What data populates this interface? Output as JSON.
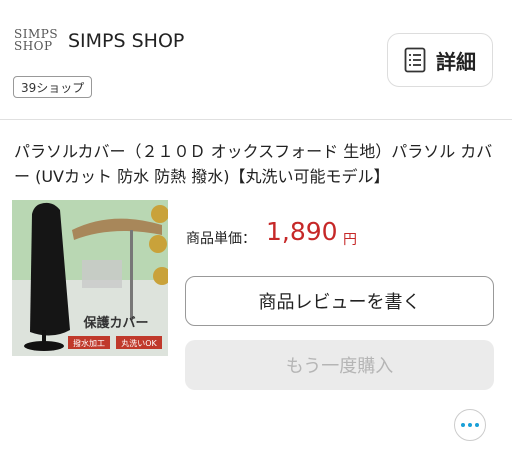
{
  "shop": {
    "logo_line1": "SIMPS",
    "logo_line2": "SHOP",
    "name": "SIMPS SHOP",
    "tag": "39ショップ"
  },
  "header": {
    "details_label": "詳細",
    "details_icon": "document-list-icon"
  },
  "product": {
    "title": "パラソルカバー（２１０Ｄ オックスフォード 生地）パラソル カバー (UVカット 防水 防熱 撥水)【丸洗い可能モデル】",
    "image": {
      "badge_text": "保護カバー",
      "tag1": "撥水加工",
      "tag2": "丸洗いOK"
    },
    "price_label": "商品単価：",
    "price_value": "1,890",
    "price_unit": "円"
  },
  "actions": {
    "review_label": "商品レビューを書く",
    "rebuy_label": "もう一度購入",
    "more_icon": "more-dots-icon"
  },
  "colors": {
    "price": "#c62828",
    "accent": "#1aa0d8",
    "disabled_bg": "#ebebeb"
  }
}
